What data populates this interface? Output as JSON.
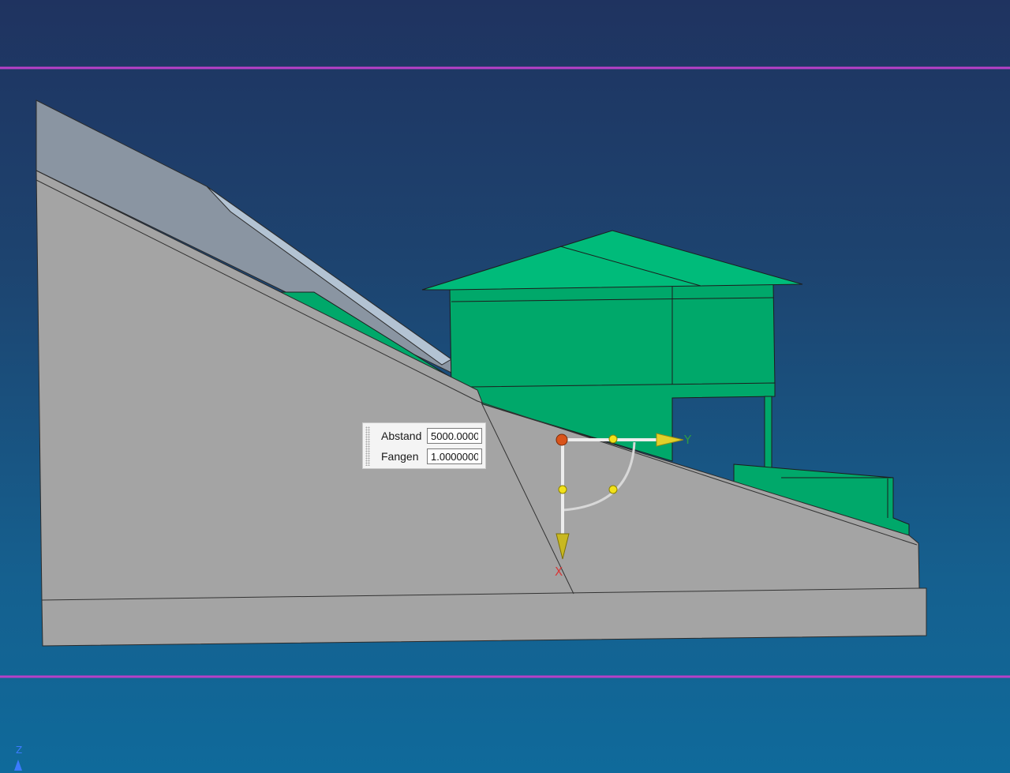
{
  "viewport": {
    "background_top": "#1f3360",
    "background_bottom": "#0f6a9b",
    "guide_line_color": "#b840c8"
  },
  "model": {
    "terrain_color": "#a4a4a4",
    "slab_color": "#8a95a2",
    "building_color": "#00a86a",
    "roof_color": "#00bb7a"
  },
  "dialog": {
    "fields": [
      {
        "label": "Abstand",
        "value": "5000.0000"
      },
      {
        "label": "Fangen",
        "value": "1.0000000"
      }
    ]
  },
  "manipulator": {
    "x_axis_label": "X",
    "y_axis_label": "Y",
    "x_color": "#d63a3a",
    "y_color": "#2c9a45",
    "handle_color": "#f2e11a",
    "origin_color": "#d9541b"
  },
  "view_triad": {
    "z_label": "Z",
    "z_color": "#3b7bff"
  }
}
